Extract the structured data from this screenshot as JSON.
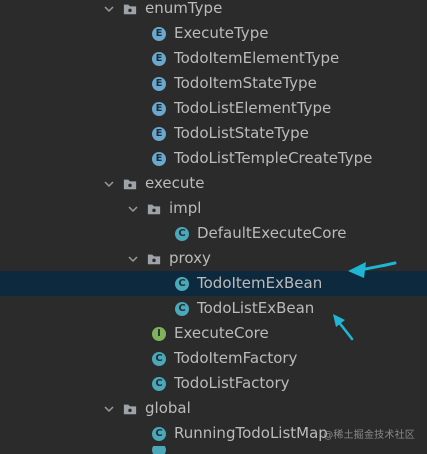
{
  "tree": {
    "rows": [
      {
        "label": "enumType",
        "kind": "package",
        "expanded": true,
        "icon": "folder-package-icon"
      },
      {
        "label": "ExecuteType",
        "kind": "enum",
        "icon": "enum-icon",
        "icon_letter": "E"
      },
      {
        "label": "TodoItemElementType",
        "kind": "enum",
        "icon": "enum-icon",
        "icon_letter": "E"
      },
      {
        "label": "TodoItemStateType",
        "kind": "enum",
        "icon": "enum-icon",
        "icon_letter": "E"
      },
      {
        "label": "TodoListElementType",
        "kind": "enum",
        "icon": "enum-icon",
        "icon_letter": "E"
      },
      {
        "label": "TodoListStateType",
        "kind": "enum",
        "icon": "enum-icon",
        "icon_letter": "E"
      },
      {
        "label": "TodoListTempleCreateType",
        "kind": "enum",
        "icon": "enum-icon",
        "icon_letter": "E"
      },
      {
        "label": "execute",
        "kind": "package",
        "expanded": true,
        "icon": "folder-package-icon"
      },
      {
        "label": "impl",
        "kind": "package",
        "expanded": true,
        "icon": "folder-package-icon"
      },
      {
        "label": "DefaultExecuteCore",
        "kind": "class",
        "icon": "class-icon",
        "icon_letter": "C"
      },
      {
        "label": "proxy",
        "kind": "package",
        "expanded": true,
        "icon": "folder-package-icon"
      },
      {
        "label": "TodoItemExBean",
        "kind": "class",
        "icon": "class-icon",
        "icon_letter": "C",
        "selected": true
      },
      {
        "label": "TodoListExBean",
        "kind": "class",
        "icon": "class-icon",
        "icon_letter": "C"
      },
      {
        "label": "ExecuteCore",
        "kind": "interface",
        "icon": "interface-icon",
        "icon_letter": "I"
      },
      {
        "label": "TodoItemFactory",
        "kind": "class",
        "icon": "class-icon",
        "icon_letter": "C"
      },
      {
        "label": "TodoListFactory",
        "kind": "class",
        "icon": "class-icon",
        "icon_letter": "C"
      },
      {
        "label": "global",
        "kind": "package",
        "expanded": true,
        "icon": "folder-package-icon"
      },
      {
        "label": "RunningTodoListMap",
        "kind": "class",
        "icon": "class-icon",
        "icon_letter": "C"
      }
    ]
  },
  "annotations": {
    "arrow_color": "#1fb6d4",
    "selected_bg": "#0d293e"
  },
  "watermark": "@稀土掘金技术社区"
}
